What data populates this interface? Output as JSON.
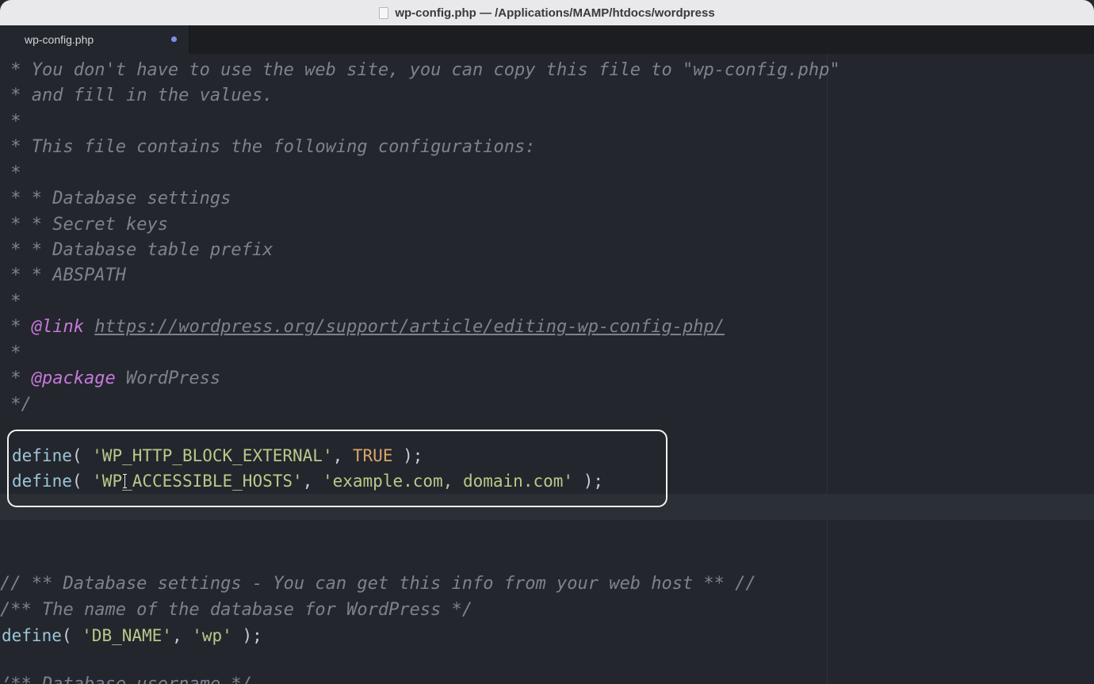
{
  "window": {
    "title": "wp-config.php — /Applications/MAMP/htdocs/wordpress"
  },
  "tabs": [
    {
      "label": "wp-config.php",
      "modified": true
    }
  ],
  "editor": {
    "lines": [
      {
        "star": " * ",
        "text": "You don't have to use the web site, you can copy this file to \"wp-config.php\""
      },
      {
        "star": " * ",
        "text": "and fill in the values."
      },
      {
        "star": " *",
        "text": ""
      },
      {
        "star": " * ",
        "text": "This file contains the following configurations:"
      },
      {
        "star": " *",
        "text": ""
      },
      {
        "star": " * ",
        "text": "* Database settings"
      },
      {
        "star": " * ",
        "text": "* Secret keys"
      },
      {
        "star": " * ",
        "text": "* Database table prefix"
      },
      {
        "star": " * ",
        "text": "* ABSPATH"
      },
      {
        "star": " *",
        "text": ""
      },
      {
        "star": " * ",
        "tag": "@link",
        "text": "https://wordpress.org/support/article/editing-wp-config-php/"
      },
      {
        "star": " *",
        "text": ""
      },
      {
        "star": " * ",
        "tag": "@package",
        "text": " WordPress"
      },
      {
        "star": " */",
        "text": ""
      }
    ],
    "define1": {
      "fn": "define",
      "open": "( ",
      "key": "'WP_HTTP_BLOCK_EXTERNAL'",
      "sep": ", ",
      "value": "TRUE",
      "close": " );"
    },
    "define2": {
      "fn": "define",
      "open": "( ",
      "key": "'WP_ACCESSIBLE_HOSTS'",
      "sep": ", ",
      "value": "'example.com, domain.com'",
      "close": " );"
    },
    "comment1": "// ** Database settings - You can get this info from your web host ** //",
    "comment2": "/** The name of the database for WordPress */",
    "define3": {
      "fn": "define",
      "open": "( ",
      "key": "'DB_NAME'",
      "sep": ", ",
      "value": "'wp'",
      "close": " );"
    },
    "comment3": "/** Database username */"
  },
  "colors": {
    "comment": "#7d838d",
    "tag": "#c678dd",
    "function": "#9cc6db",
    "string": "#b9c98a",
    "constant": "#d8a66a",
    "highlight_box": "#f2f2f2"
  }
}
